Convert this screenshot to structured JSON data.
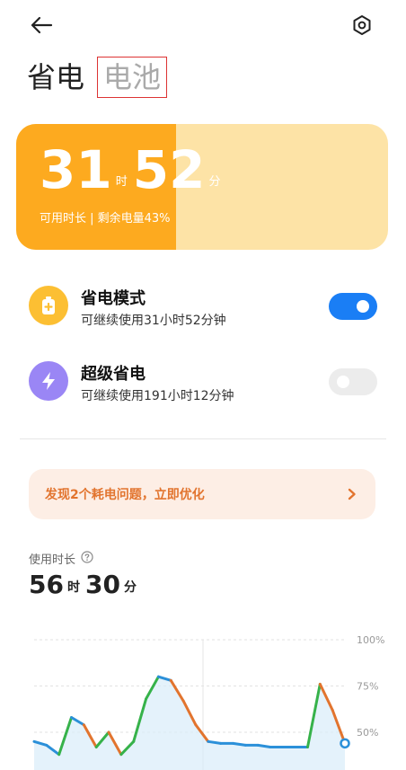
{
  "header": {
    "back_icon": "arrow-left-icon",
    "settings_icon": "hexagon-gear-icon"
  },
  "tabs": [
    {
      "label": "省电",
      "active": true
    },
    {
      "label": "电池",
      "active": false
    }
  ],
  "battery": {
    "hours": "31",
    "hours_unit": "时",
    "minutes": "52",
    "minutes_unit": "分",
    "subtitle": "可用时长 | 剩余电量43%",
    "level_percent": 43,
    "colors": {
      "fill": "#fdaa1f",
      "track": "#fde3a6"
    }
  },
  "modes": [
    {
      "title": "省电模式",
      "subtitle": "可继续使用31小时52分钟",
      "icon": "battery-plus-icon",
      "icon_color": "#fcbf33",
      "enabled": true
    },
    {
      "title": "超级省电",
      "subtitle": "可继续使用191小时12分钟",
      "icon": "lightning-icon",
      "icon_color": "#9a86f5",
      "enabled": false
    }
  ],
  "issue_banner": {
    "text": "发现2个耗电问题，立即优化",
    "arrow_icon": "chevron-right-icon",
    "color": "#e2742e"
  },
  "usage": {
    "label": "使用时长",
    "help_icon": "question-circle-icon",
    "hours": "56",
    "hours_unit": "时",
    "minutes": "30",
    "minutes_unit": "分"
  },
  "chart_data": {
    "type": "line",
    "y_tick_labels": [
      "100%",
      "75%",
      "50%"
    ],
    "ylim": [
      0,
      100
    ],
    "x": [
      0,
      1,
      2,
      3,
      4,
      5,
      6,
      7,
      8,
      9,
      10,
      11,
      12,
      13,
      14,
      15,
      16,
      17,
      18,
      19,
      20,
      21,
      22,
      23,
      24,
      25
    ],
    "values": [
      45,
      43,
      38,
      58,
      54,
      42,
      50,
      38,
      45,
      68,
      80,
      78,
      67,
      54,
      45,
      44,
      44,
      43,
      43,
      42,
      42,
      42,
      42,
      76,
      62,
      44
    ],
    "grid": true,
    "colors": {
      "line": "#2b90d9",
      "charging": "#36b24a",
      "draining": "#e2742e",
      "fill": "#d9ecfa"
    }
  }
}
